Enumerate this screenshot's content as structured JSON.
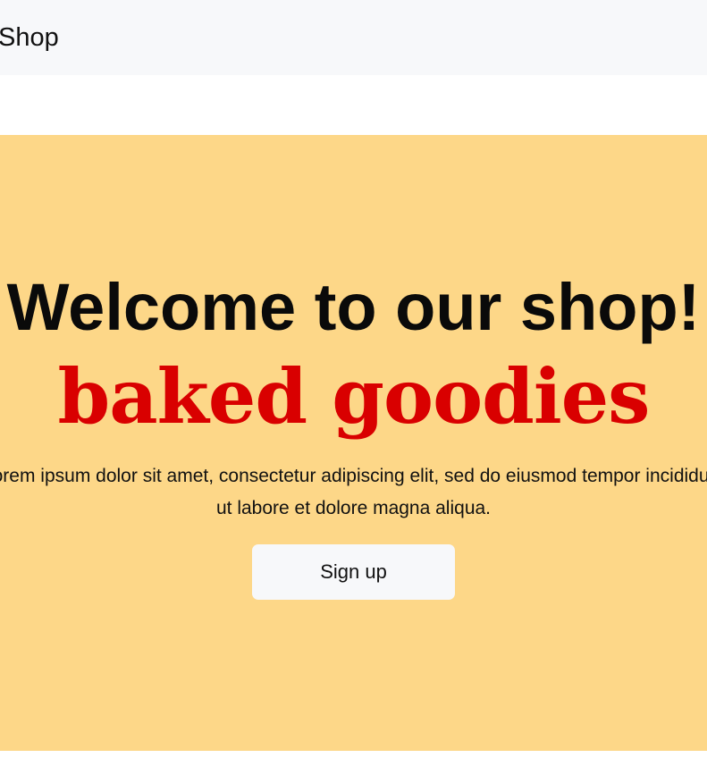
{
  "navbar": {
    "brand": "Shop"
  },
  "hero": {
    "title": "Welcome to our shop!",
    "subtitle": "baked goodies",
    "text_line1": "Lorem ipsum dolor sit amet, consectetur adipiscing elit, sed do eiusmod tempor incididunt",
    "text_line2": "ut labore et dolore magna aliqua.",
    "button_label": "Sign up"
  },
  "colors": {
    "navbar_bg": "#f7f8fa",
    "hero_bg": "#fdd788",
    "accent_red": "#d90000",
    "button_bg": "#f7f8fa"
  }
}
